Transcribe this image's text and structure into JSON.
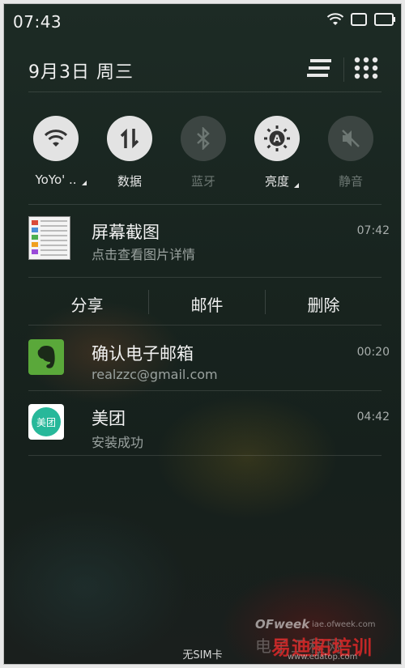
{
  "status_bar": {
    "time": "07:43"
  },
  "header": {
    "date": "9月3日  周三"
  },
  "toggles": [
    {
      "label": "YoYo' ..",
      "icon": "wifi-icon",
      "state": "on",
      "has_caret": true
    },
    {
      "label": "数据",
      "icon": "data-transfer-icon",
      "state": "on",
      "has_caret": false
    },
    {
      "label": "蓝牙",
      "icon": "bluetooth-icon",
      "state": "off",
      "has_caret": false
    },
    {
      "label": "亮度",
      "icon": "brightness-auto-icon",
      "state": "on",
      "has_caret": true
    },
    {
      "label": "静音",
      "icon": "mute-icon",
      "state": "off",
      "has_caret": false
    }
  ],
  "notifications": [
    {
      "title": "屏幕截图",
      "subtitle": "点击查看图片详情",
      "time": "07:42",
      "icon": "screenshot-thumbnail"
    },
    {
      "title": "确认电子邮箱",
      "subtitle": "realzzc@gmail.com",
      "time": "00:20",
      "icon": "evernote-icon"
    },
    {
      "title": "美团",
      "subtitle": "安装成功",
      "time": "04:42",
      "icon": "meituan-icon",
      "icon_text": "美团"
    }
  ],
  "actions": {
    "share": "分享",
    "email": "邮件",
    "delete": "删除"
  },
  "footer": {
    "sim_status": "无SIM卡"
  },
  "watermark": {
    "brand": "OFweek",
    "site": "iae.ofweek.com",
    "site2": "www.edatop.com",
    "text_cn": "电子工程网",
    "text_cn2": "易迪拓培训"
  },
  "colors": {
    "toggle_on": "#e3e3e3",
    "toggle_off": "#3c4542",
    "evernote_green": "#5aa83a",
    "meituan_teal": "#27b89a"
  }
}
